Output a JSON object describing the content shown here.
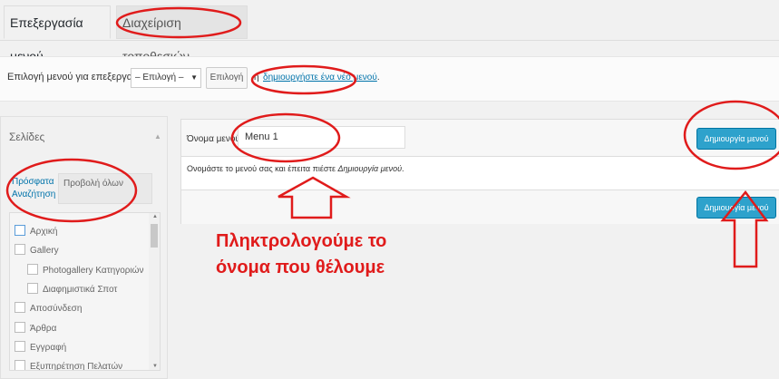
{
  "tabs": [
    {
      "label": "Επεξεργασία μενού",
      "active": true
    },
    {
      "label": "Διαχείριση τοποθεσιών",
      "active": false
    }
  ],
  "menu_select": {
    "label": "Επιλογή μενού για επεξεργασία:",
    "selected": "– Επιλογή –",
    "button": "Επιλογή",
    "or_text": "ή",
    "create_link": "δημιουργήστε ένα νέο μενού",
    "period": "."
  },
  "pages_panel": {
    "title": "Σελίδες",
    "tab_recent": "Πρόσφατα Αναζήτηση",
    "tab_view_all": "Προβολή όλων",
    "items": [
      "Αρχική",
      "Gallery",
      "Photogallery Κατηγοριών",
      "Διαφημιστικά Σποτ",
      "Αποσύνδεση",
      "Άρθρα",
      "Εγγραφή",
      "Εξυπηρέτηση Πελατών"
    ]
  },
  "menu_editor": {
    "name_label": "Όνομα μενού",
    "name_value": "Menu 1",
    "create_button": "Δημιουργία μενού",
    "hint_prefix": "Ονομάστε το μενού σας και έπειτα πιέστε ",
    "hint_emphasis": "Δημιουργία μενού",
    "hint_suffix": "."
  },
  "annotation": {
    "line1": "Πληκτρολογούμε το",
    "line2": "όνομα που θέλουμε",
    "color": "#e01b1b"
  },
  "colors": {
    "accent_button": "#2ea2cc",
    "link": "#0073aa",
    "annotation_red": "#e01b1b"
  }
}
